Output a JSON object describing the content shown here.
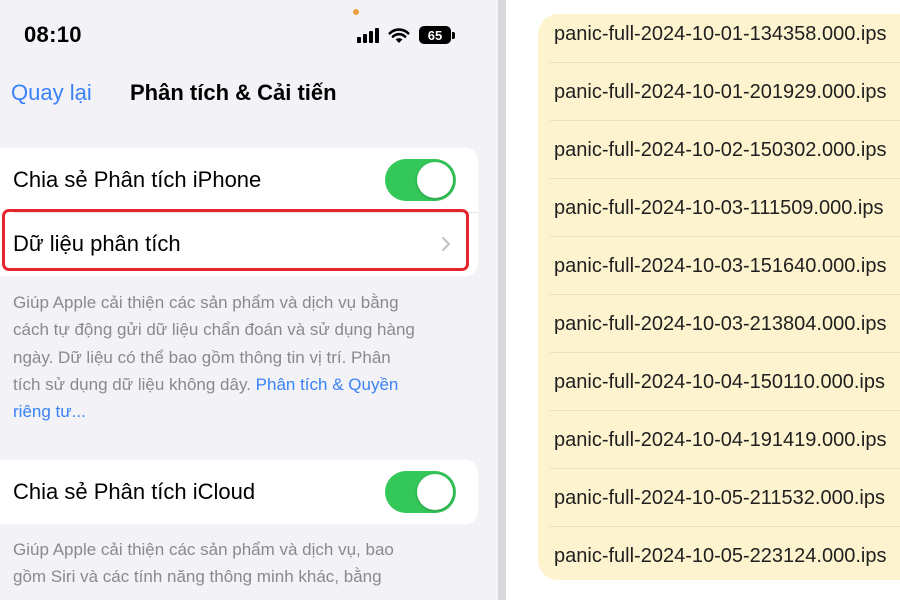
{
  "status_bar": {
    "time": "08:10",
    "battery": "65"
  },
  "nav": {
    "back_label": "Quay lại",
    "title": "Phân tích & Cải tiến"
  },
  "settings": {
    "share_iphone_label": "Chia sẻ Phân tích iPhone",
    "share_iphone_on": true,
    "analytics_data_label": "Dữ liệu phân tích",
    "desc1_lines": [
      "Giúp Apple cải thiện các sản phẩm và dịch vụ bằng",
      "cách tự động gửi dữ liệu chẩn đoán và sử dụng hàng",
      "ngày. Dữ liệu có thể bao gồm thông tin vị trí. Phân",
      "tích sử dụng dữ liệu không dây. "
    ],
    "desc1_link_a": "Phân tích & Quyền",
    "desc1_link_b": "riêng tư...",
    "share_icloud_label": "Chia sẻ Phân tích iCloud",
    "share_icloud_on": true,
    "desc2_lines": [
      "Giúp Apple cải thiện các sản phẩm và dịch vụ, bao",
      "gồm Siri và các tính năng thông minh khác, bằng"
    ]
  },
  "files": [
    "panic-full-2024-10-01-134358.000.ips",
    "panic-full-2024-10-01-201929.000.ips",
    "panic-full-2024-10-02-150302.000.ips",
    "panic-full-2024-10-03-111509.000.ips",
    "panic-full-2024-10-03-151640.000.ips",
    "panic-full-2024-10-03-213804.000.ips",
    "panic-full-2024-10-04-150110.000.ips",
    "panic-full-2024-10-04-191419.000.ips",
    "panic-full-2024-10-05-211532.000.ips",
    "panic-full-2024-10-05-223124.000.ips"
  ],
  "colors": {
    "accent": "#3a82f7",
    "toggle_on": "#34c759",
    "highlight": "#e4252c",
    "file_bg": "#fdf3cf"
  },
  "icons": {
    "chevron": "chevron-right-icon",
    "wifi": "wifi-icon",
    "signal": "cellular-signal-icon",
    "battery": "battery-icon"
  }
}
